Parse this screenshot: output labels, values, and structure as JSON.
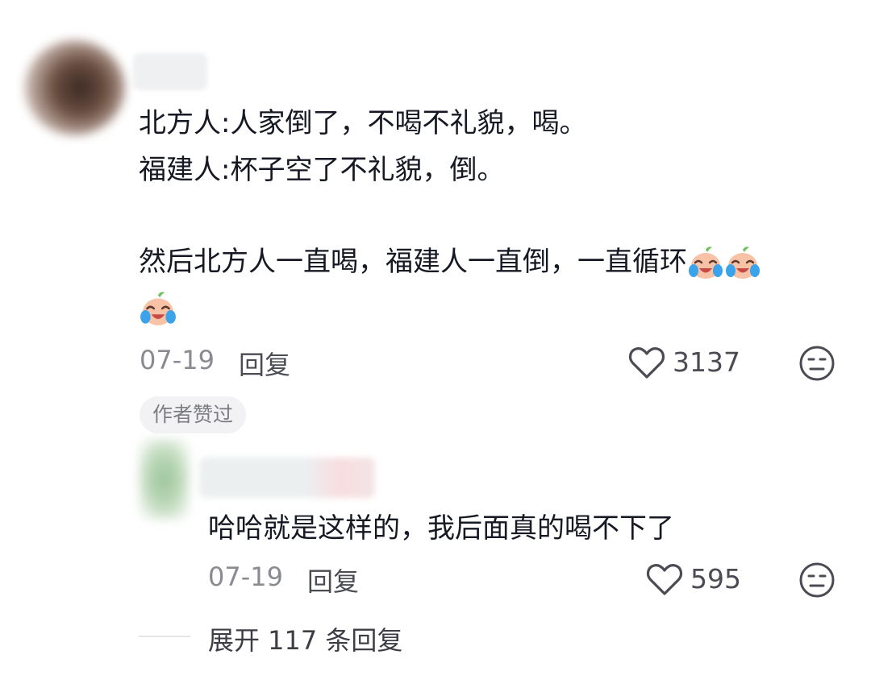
{
  "comment": {
    "lines": [
      "北方人:人家倒了，不喝不礼貌，喝。",
      "福建人:杯子空了不礼貌，倒。",
      "然后北方人一直喝，福建人一直倒，一直循环"
    ],
    "emoji_icon": "laughing-crying-peach-emoji",
    "date": "07-19",
    "reply_label": "回复",
    "like_count": "3137",
    "author_liked_badge": "作者赞过"
  },
  "reply": {
    "text": "哈哈就是这样的，我后面真的喝不下了",
    "date": "07-19",
    "reply_label": "回复",
    "like_count": "595"
  },
  "expand_replies": "展开 117 条回复",
  "icons": {
    "like": "heart-outline-icon",
    "dislike": "meh-face-icon"
  },
  "colors": {
    "text_primary": "#161823",
    "text_secondary": "#8a8b91",
    "badge_bg": "#f2f2f4"
  }
}
